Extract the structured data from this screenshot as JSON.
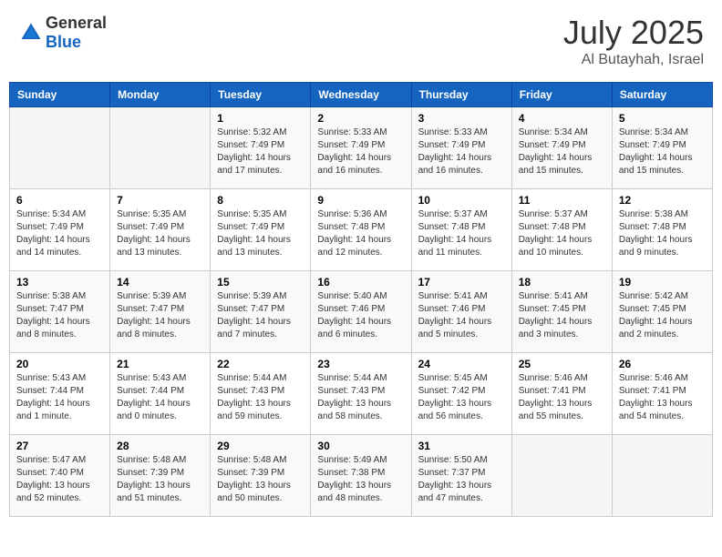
{
  "header": {
    "logo_general": "General",
    "logo_blue": "Blue",
    "month_year": "July 2025",
    "location": "Al Butayhah, Israel"
  },
  "weekdays": [
    "Sunday",
    "Monday",
    "Tuesday",
    "Wednesday",
    "Thursday",
    "Friday",
    "Saturday"
  ],
  "weeks": [
    [
      {
        "day": "",
        "sunrise": "",
        "sunset": "",
        "daylight": "",
        "empty": true
      },
      {
        "day": "",
        "sunrise": "",
        "sunset": "",
        "daylight": "",
        "empty": true
      },
      {
        "day": "1",
        "sunrise": "Sunrise: 5:32 AM",
        "sunset": "Sunset: 7:49 PM",
        "daylight": "Daylight: 14 hours and 17 minutes."
      },
      {
        "day": "2",
        "sunrise": "Sunrise: 5:33 AM",
        "sunset": "Sunset: 7:49 PM",
        "daylight": "Daylight: 14 hours and 16 minutes."
      },
      {
        "day": "3",
        "sunrise": "Sunrise: 5:33 AM",
        "sunset": "Sunset: 7:49 PM",
        "daylight": "Daylight: 14 hours and 16 minutes."
      },
      {
        "day": "4",
        "sunrise": "Sunrise: 5:34 AM",
        "sunset": "Sunset: 7:49 PM",
        "daylight": "Daylight: 14 hours and 15 minutes."
      },
      {
        "day": "5",
        "sunrise": "Sunrise: 5:34 AM",
        "sunset": "Sunset: 7:49 PM",
        "daylight": "Daylight: 14 hours and 15 minutes."
      }
    ],
    [
      {
        "day": "6",
        "sunrise": "Sunrise: 5:34 AM",
        "sunset": "Sunset: 7:49 PM",
        "daylight": "Daylight: 14 hours and 14 minutes."
      },
      {
        "day": "7",
        "sunrise": "Sunrise: 5:35 AM",
        "sunset": "Sunset: 7:49 PM",
        "daylight": "Daylight: 14 hours and 13 minutes."
      },
      {
        "day": "8",
        "sunrise": "Sunrise: 5:35 AM",
        "sunset": "Sunset: 7:49 PM",
        "daylight": "Daylight: 14 hours and 13 minutes."
      },
      {
        "day": "9",
        "sunrise": "Sunrise: 5:36 AM",
        "sunset": "Sunset: 7:48 PM",
        "daylight": "Daylight: 14 hours and 12 minutes."
      },
      {
        "day": "10",
        "sunrise": "Sunrise: 5:37 AM",
        "sunset": "Sunset: 7:48 PM",
        "daylight": "Daylight: 14 hours and 11 minutes."
      },
      {
        "day": "11",
        "sunrise": "Sunrise: 5:37 AM",
        "sunset": "Sunset: 7:48 PM",
        "daylight": "Daylight: 14 hours and 10 minutes."
      },
      {
        "day": "12",
        "sunrise": "Sunrise: 5:38 AM",
        "sunset": "Sunset: 7:48 PM",
        "daylight": "Daylight: 14 hours and 9 minutes."
      }
    ],
    [
      {
        "day": "13",
        "sunrise": "Sunrise: 5:38 AM",
        "sunset": "Sunset: 7:47 PM",
        "daylight": "Daylight: 14 hours and 8 minutes."
      },
      {
        "day": "14",
        "sunrise": "Sunrise: 5:39 AM",
        "sunset": "Sunset: 7:47 PM",
        "daylight": "Daylight: 14 hours and 8 minutes."
      },
      {
        "day": "15",
        "sunrise": "Sunrise: 5:39 AM",
        "sunset": "Sunset: 7:47 PM",
        "daylight": "Daylight: 14 hours and 7 minutes."
      },
      {
        "day": "16",
        "sunrise": "Sunrise: 5:40 AM",
        "sunset": "Sunset: 7:46 PM",
        "daylight": "Daylight: 14 hours and 6 minutes."
      },
      {
        "day": "17",
        "sunrise": "Sunrise: 5:41 AM",
        "sunset": "Sunset: 7:46 PM",
        "daylight": "Daylight: 14 hours and 5 minutes."
      },
      {
        "day": "18",
        "sunrise": "Sunrise: 5:41 AM",
        "sunset": "Sunset: 7:45 PM",
        "daylight": "Daylight: 14 hours and 3 minutes."
      },
      {
        "day": "19",
        "sunrise": "Sunrise: 5:42 AM",
        "sunset": "Sunset: 7:45 PM",
        "daylight": "Daylight: 14 hours and 2 minutes."
      }
    ],
    [
      {
        "day": "20",
        "sunrise": "Sunrise: 5:43 AM",
        "sunset": "Sunset: 7:44 PM",
        "daylight": "Daylight: 14 hours and 1 minute."
      },
      {
        "day": "21",
        "sunrise": "Sunrise: 5:43 AM",
        "sunset": "Sunset: 7:44 PM",
        "daylight": "Daylight: 14 hours and 0 minutes."
      },
      {
        "day": "22",
        "sunrise": "Sunrise: 5:44 AM",
        "sunset": "Sunset: 7:43 PM",
        "daylight": "Daylight: 13 hours and 59 minutes."
      },
      {
        "day": "23",
        "sunrise": "Sunrise: 5:44 AM",
        "sunset": "Sunset: 7:43 PM",
        "daylight": "Daylight: 13 hours and 58 minutes."
      },
      {
        "day": "24",
        "sunrise": "Sunrise: 5:45 AM",
        "sunset": "Sunset: 7:42 PM",
        "daylight": "Daylight: 13 hours and 56 minutes."
      },
      {
        "day": "25",
        "sunrise": "Sunrise: 5:46 AM",
        "sunset": "Sunset: 7:41 PM",
        "daylight": "Daylight: 13 hours and 55 minutes."
      },
      {
        "day": "26",
        "sunrise": "Sunrise: 5:46 AM",
        "sunset": "Sunset: 7:41 PM",
        "daylight": "Daylight: 13 hours and 54 minutes."
      }
    ],
    [
      {
        "day": "27",
        "sunrise": "Sunrise: 5:47 AM",
        "sunset": "Sunset: 7:40 PM",
        "daylight": "Daylight: 13 hours and 52 minutes."
      },
      {
        "day": "28",
        "sunrise": "Sunrise: 5:48 AM",
        "sunset": "Sunset: 7:39 PM",
        "daylight": "Daylight: 13 hours and 51 minutes."
      },
      {
        "day": "29",
        "sunrise": "Sunrise: 5:48 AM",
        "sunset": "Sunset: 7:39 PM",
        "daylight": "Daylight: 13 hours and 50 minutes."
      },
      {
        "day": "30",
        "sunrise": "Sunrise: 5:49 AM",
        "sunset": "Sunset: 7:38 PM",
        "daylight": "Daylight: 13 hours and 48 minutes."
      },
      {
        "day": "31",
        "sunrise": "Sunrise: 5:50 AM",
        "sunset": "Sunset: 7:37 PM",
        "daylight": "Daylight: 13 hours and 47 minutes."
      },
      {
        "day": "",
        "sunrise": "",
        "sunset": "",
        "daylight": "",
        "empty": true
      },
      {
        "day": "",
        "sunrise": "",
        "sunset": "",
        "daylight": "",
        "empty": true
      }
    ]
  ]
}
